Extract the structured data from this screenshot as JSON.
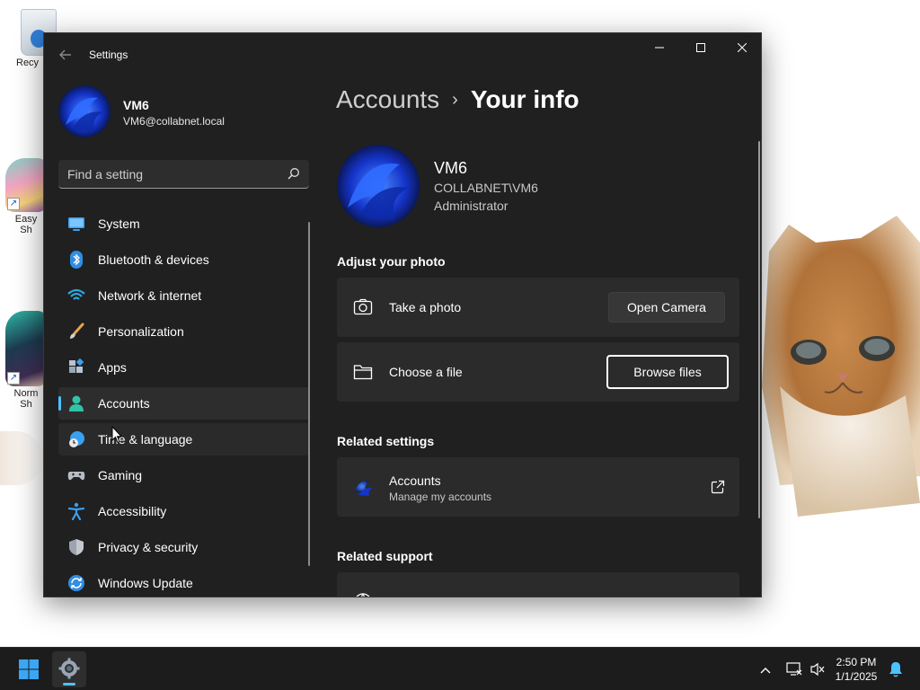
{
  "desktop": {
    "icons": [
      {
        "label": "Recy",
        "name": "recycle-bin"
      },
      {
        "label": "Easy\nSh",
        "name": "easy-shortcut"
      },
      {
        "label": "Norm\nSh",
        "name": "normal-shortcut"
      }
    ]
  },
  "window": {
    "title": "Settings",
    "controls": {
      "minimize": "—",
      "maximize": "▢",
      "close": "✕"
    }
  },
  "profile": {
    "name": "VM6",
    "email": "VM6@collabnet.local"
  },
  "search": {
    "placeholder": "Find a setting"
  },
  "sidebar": {
    "items": [
      {
        "label": "System",
        "icon": "monitor-icon"
      },
      {
        "label": "Bluetooth & devices",
        "icon": "bluetooth-icon"
      },
      {
        "label": "Network & internet",
        "icon": "wifi-icon"
      },
      {
        "label": "Personalization",
        "icon": "brush-icon"
      },
      {
        "label": "Apps",
        "icon": "apps-icon"
      },
      {
        "label": "Accounts",
        "icon": "person-icon",
        "active": true
      },
      {
        "label": "Time & language",
        "icon": "clock-globe-icon"
      },
      {
        "label": "Gaming",
        "icon": "gamepad-icon"
      },
      {
        "label": "Accessibility",
        "icon": "accessibility-icon"
      },
      {
        "label": "Privacy & security",
        "icon": "shield-icon"
      },
      {
        "label": "Windows Update",
        "icon": "update-icon"
      }
    ]
  },
  "main": {
    "breadcrumb": {
      "parent": "Accounts",
      "separator": "›",
      "current": "Your info"
    },
    "user": {
      "name": "VM6",
      "domain": "COLLABNET\\VM6",
      "role": "Administrator"
    },
    "adjust_photo": {
      "heading": "Adjust your photo",
      "take_photo": {
        "label": "Take a photo",
        "button": "Open Camera"
      },
      "choose_file": {
        "label": "Choose a file",
        "button": "Browse files"
      }
    },
    "related_settings": {
      "heading": "Related settings",
      "accounts": {
        "title": "Accounts",
        "subtitle": "Manage my accounts"
      }
    },
    "related_support": {
      "heading": "Related support"
    }
  },
  "taskbar": {
    "time": "2:50 PM",
    "date": "1/1/2025",
    "tray": {
      "chevron": "^"
    }
  },
  "colors": {
    "accent": "#4cc2ff",
    "window_bg": "#202020",
    "card_bg": "#2b2b2b"
  }
}
